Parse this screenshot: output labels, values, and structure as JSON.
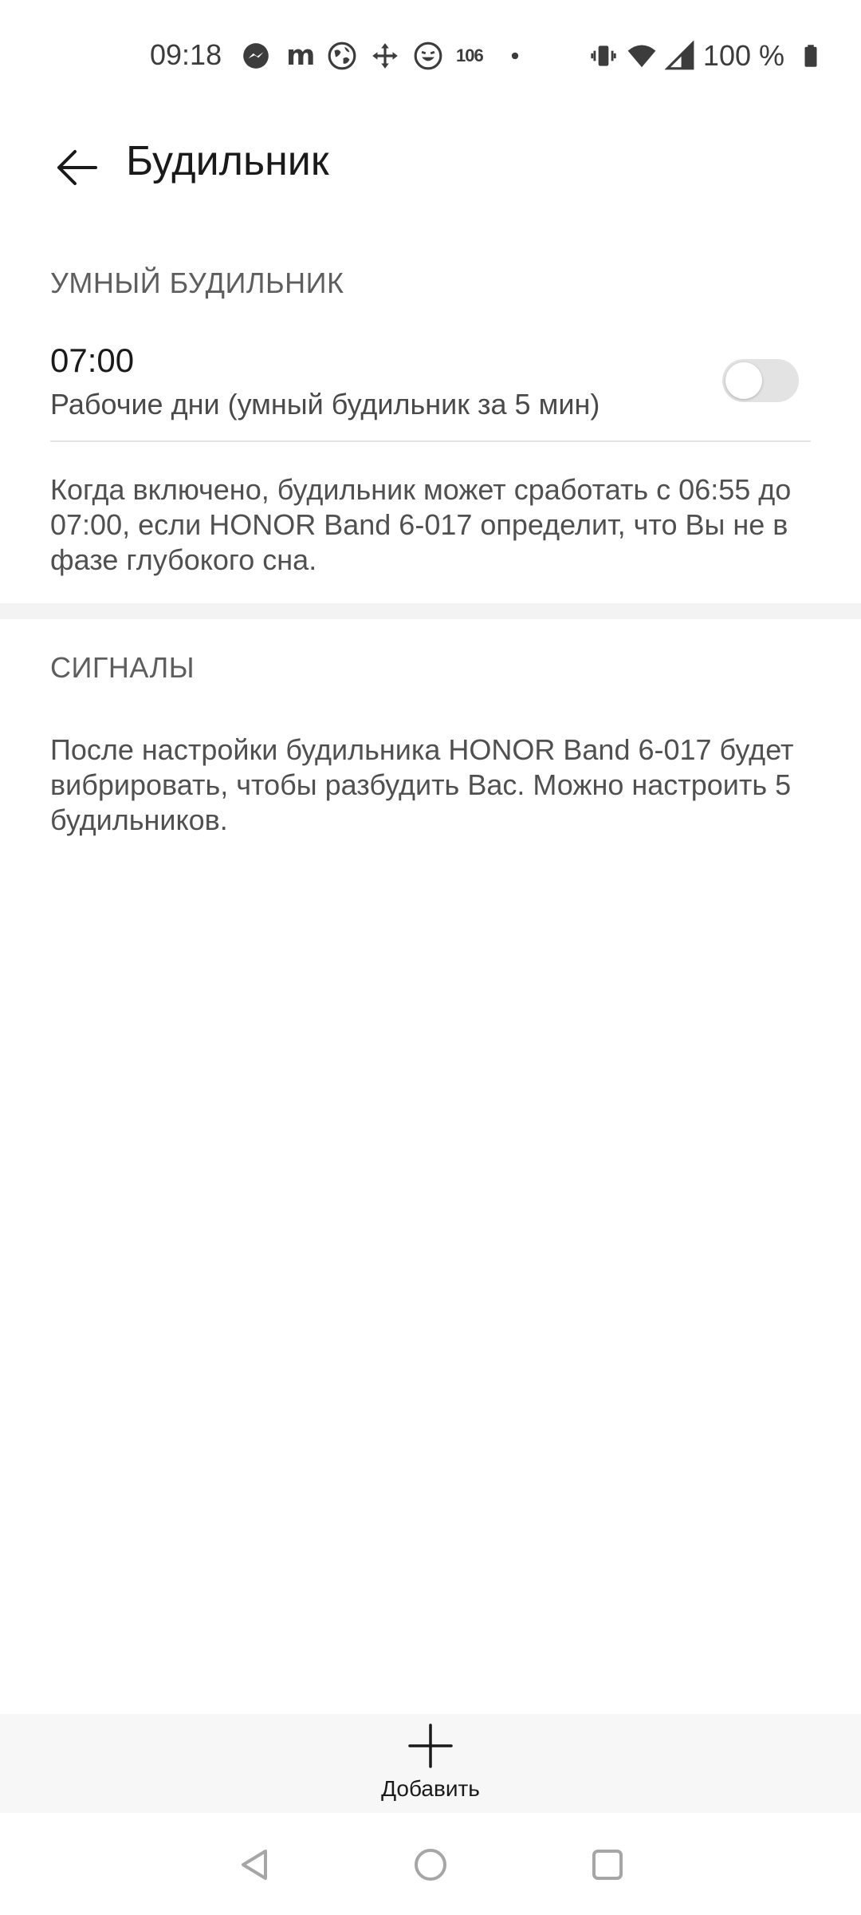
{
  "status_bar": {
    "time": "09:18",
    "notification_count": "106",
    "battery": "100 %",
    "icons_left": [
      "messenger-icon",
      "m-app-icon",
      "globe-icon",
      "move-icon",
      "laughing-face-icon",
      "notification-count",
      "dot-icon"
    ],
    "icons_right": [
      "vibrate-icon",
      "wifi-icon",
      "cellular-signal-icon",
      "battery-icon"
    ]
  },
  "app_bar": {
    "title": "Будильник"
  },
  "smart_alarm": {
    "header": "УМНЫЙ БУДИЛЬНИК",
    "alarm_time": "07:00",
    "alarm_subtitle": "Рабочие дни (умный будильник за 5 мин)",
    "enabled": false,
    "description": "Когда включено, будильник может сработать с 06:55 до 07:00, если HONOR Band 6-017 определит, что Вы не в фазе глубокого сна."
  },
  "signals": {
    "header": "СИГНАЛЫ",
    "description": "После настройки будильника HONOR Band 6-017 будет вибрировать, чтобы разбудить Вас. Можно настроить 5 будильников."
  },
  "bottom_bar": {
    "add_label": "Добавить"
  },
  "nav_bar": {
    "buttons": [
      "back-triangle-icon",
      "home-circle-icon",
      "recents-square-icon"
    ]
  },
  "colors": {
    "background": "#ffffff",
    "text_primary": "#1a1a1a",
    "text_secondary": "#5e5e5e",
    "toggle_off": "#e3e3e3",
    "bottom_bar": "#f7f7f7"
  }
}
